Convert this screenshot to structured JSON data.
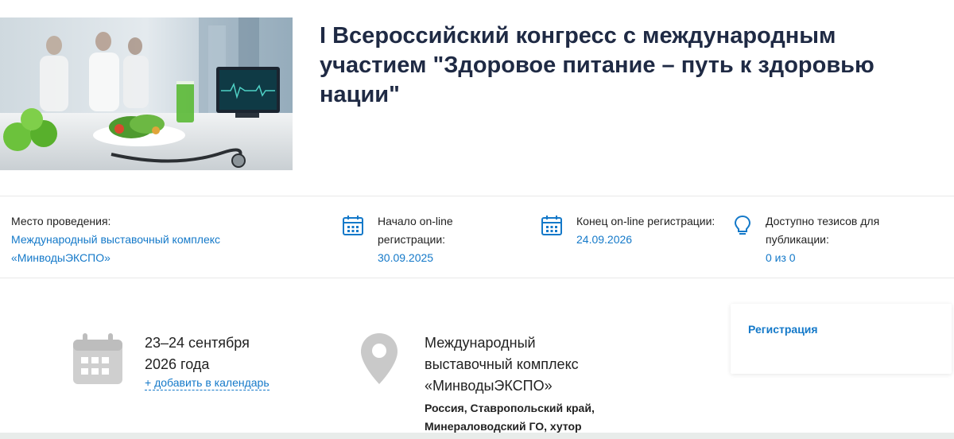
{
  "hero": {
    "title": "I Всероссийский конгресс с международным участием \"Здоровое питание – путь к здоровью нации\""
  },
  "info": {
    "venue": {
      "label": "Место проведения:",
      "value": "Международный выставочный комплекс «МинводыЭКСПО»"
    },
    "reg_start": {
      "label": "Начало on-line регистрации:",
      "value": "30.09.2025"
    },
    "reg_end": {
      "label": "Конец on-line регистрации:",
      "value": "24.09.2026"
    },
    "theses": {
      "label": "Доступно тезисов для публикации:",
      "value": "0 из 0"
    }
  },
  "event": {
    "dates": "23–24 сентября 2026 года",
    "add_to_calendar": "+ добавить в календарь",
    "venue_name": "Международный выставочный комплекс «МинводыЭКСПО»",
    "venue_address": "Россия, Ставропольский край, Минераловодский ГО, хутор"
  },
  "sidebar": {
    "registration_link": "Регистрация"
  },
  "colors": {
    "accent": "#1479c9",
    "title": "#1f2a44",
    "icon_gray": "#c9c9c9"
  },
  "icons": [
    "calendar-icon",
    "lightbulb-icon",
    "map-pin-icon"
  ]
}
